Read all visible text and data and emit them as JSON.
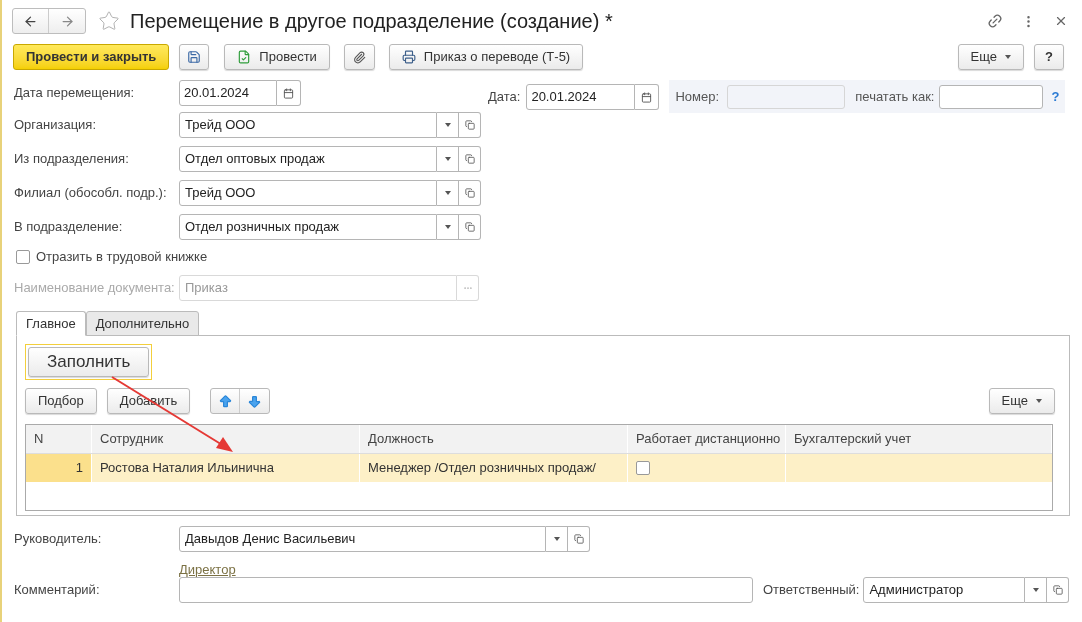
{
  "window": {
    "title": "Перемещение в другое подразделение (создание) *"
  },
  "toolbar": {
    "post_close": "Провести и закрыть",
    "post": "Провести",
    "print": "Приказ о переводе (Т-5)",
    "more": "Еще",
    "help": "?"
  },
  "move_date": {
    "label": "Дата перемещения:",
    "value": "20.01.2024"
  },
  "doc_date": {
    "label": "Дата:",
    "value": "20.01.2024"
  },
  "number": {
    "label": "Номер:",
    "disabled": true
  },
  "print_as": {
    "label": "печатать как:"
  },
  "help_link": "?",
  "fields": [
    {
      "label": "Организация:",
      "value": "Трейд ООО"
    },
    {
      "label": "Из подразделения:",
      "value": "Отдел оптовых продаж"
    },
    {
      "label": "Филиал (обособл. подр.):",
      "value": "Трейд ООО"
    },
    {
      "label": "В подразделение:",
      "value": "Отдел розничных продаж"
    }
  ],
  "work_book": {
    "label": "Отразить в трудовой книжке",
    "checked": false
  },
  "document_name": {
    "label": "Наименование документа:",
    "value": "Приказ",
    "disabled": true
  },
  "tabs": [
    {
      "label": "Главное",
      "selected": true
    },
    {
      "label": "Дополнительно",
      "selected": false
    }
  ],
  "fill_button": "Заполнить",
  "table_toolbar": {
    "pick": "Подбор",
    "add": "Добавить",
    "more": "Еще"
  },
  "table": {
    "columns": [
      "N",
      "Сотрудник",
      "Должность",
      "Работает дистанционно",
      "Бухгалтерский учет"
    ],
    "rows": [
      {
        "n": "1",
        "employee": "Ростова Наталия Ильинична",
        "position": "Менеджер /Отдел розничных продаж/",
        "remote": false,
        "selected": true
      }
    ]
  },
  "manager": {
    "label": "Руководитель:",
    "value": "Давыдов Денис Васильевич",
    "position_link": "Директор"
  },
  "comment": {
    "label": "Комментарий:"
  },
  "responsible": {
    "label": "Ответственный:",
    "value": "Администратор"
  }
}
